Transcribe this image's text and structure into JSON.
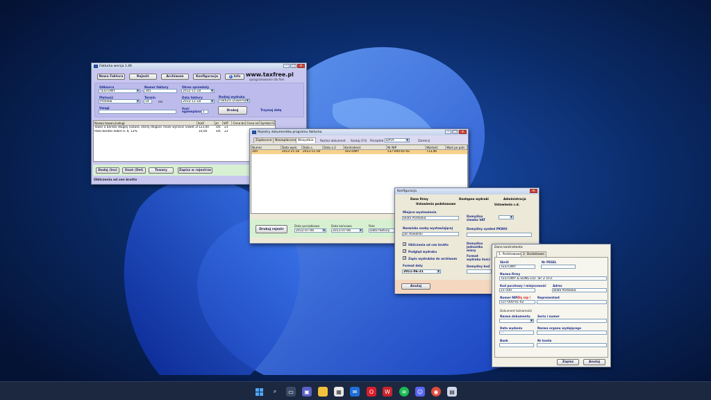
{
  "w1": {
    "title": "Fakturka wersja 1.46",
    "menu": [
      "Nowa Faktura",
      "Rejestr",
      "Archiwum",
      "Konfiguracja",
      "Info"
    ],
    "logo": "www.taxfree.pl",
    "logo_sub": "oprogramowanie dla firm",
    "odbiorca_lbl": "Odbiorca",
    "odbiorca": "TESTOWY",
    "numer_lbl": "Numer faktury",
    "numer": "345",
    "okres_lbl": "Okres sprzedaży",
    "okres": "2012-11-18",
    "platnosc_lbl": "Płatność",
    "platnosc": "Przelew",
    "termin_lbl": "Termin",
    "termin": "14",
    "dni": "dni",
    "data_lbl": "Data faktury",
    "data": "2012-11-18",
    "rodzaj_lbl": "Rodzaj wydruku",
    "rodzaj": "Faktura uniwersalna",
    "uwagi_lbl": "Uwagi",
    "ilosc_lbl": "Ilość egzemplarzy",
    "ilosc": "1",
    "drukuj": "Drukuj",
    "trzymaj": "Trzymaj datę",
    "cols": [
      "Nazwa towaru/usługi",
      "Ilość",
      "jm",
      "VAT",
      "Cena brutto",
      "Cena netto",
      "Symbol SWW"
    ],
    "rows": [
      [
        "Towar o bardzo długiej nazwie, której długość może wynosić nawet 200 znaków",
        "123,00",
        "szt.",
        "23",
        "",
        "",
        " "
      ],
      [
        "Pozo bardzo dobre 0..9, 12%",
        "10,00",
        "szt.",
        "23",
        "",
        "",
        ""
      ]
    ],
    "buttons": [
      "Dodaj (Ins)",
      "Usuń (Del)",
      "Towary",
      "Zapisz w rejestrze"
    ],
    "status": "Obliczenia od cen brutto"
  },
  "w2": {
    "title": "Rejestry dokumentów programu fakturka",
    "tabs": [
      "Zapłacone",
      "Niezapłacone",
      "Wszystkie",
      "Rozlicz dokument",
      "Szukaj (F3)",
      "Porządek:"
    ],
    "porzadek": "DATA",
    "zamknij": "Zamknij",
    "cols": [
      "Numer",
      "Data wyst.",
      "Data s.",
      "Data o.2",
      "Kontrahent",
      "Nr NIP",
      "Wartość",
      "Wart.po potr."
    ],
    "row": [
      "345",
      "2012-11-18",
      "2012-11-18",
      "",
      "TESTOWY",
      "537-000-01-02",
      "713,46",
      ""
    ],
    "drukuj": "Drukuj rejestr",
    "dp_lbl": "Data początkowa",
    "dp": "2012-07-06",
    "dk_lbl": "Data końcowa",
    "dk": "2011-07-06",
    "pole_lbl": "Pole",
    "pole": "Data faktury"
  },
  "w3": {
    "title": "Konfiguracja",
    "tabs": [
      "Dane firmy",
      "Dostępne wydruki",
      "Administracja"
    ],
    "subtabs": [
      "Ustawienia podstawowe",
      "Ustawienia c.d."
    ],
    "miejsce_lbl": "Miejsce wystawienia",
    "miejsce": "Biała Podlaska",
    "osoba_lbl": "Nazwisko osoby wystawiającej",
    "osoba": "Jan Kowalski",
    "checks": [
      "Obliczenia od cen brutto",
      "Podgląd wydruku",
      "Zapis wydruków do archiwum"
    ],
    "format_lbl": "Format daty",
    "format": "2011-06-21",
    "vat_lbl": "Domyślna stawka VAT",
    "pkwiu_lbl": "Domyślny symbol PKWiU",
    "jedn_lbl": "Domyślna jednostka miary",
    "format_wyd_lbl": "Format wydruku ilości (miejsca po przecinku)",
    "kod_lbl": "Domyślny kod",
    "anuluj": "Anuluj"
  },
  "w4": {
    "title": "Dane kontrahenta",
    "tabs": [
      "1. Podstawowe",
      "2. Dodatkowe"
    ],
    "skrot_lbl": "Skrót",
    "skrot": "TESTOWY",
    "pesel_lbl": "Nr PESEL",
    "nazwa_lbl": "Nazwa firmy",
    "nazwa": "TESTOWY & SONS LTD. SP. Z O.O.",
    "kod_lbl": "Kod pocztowy i miejscowość",
    "kod": "21-500",
    "adres_lbl": "Adres",
    "adres": "Biała Podlaska",
    "nip_lbl": "Numer NIP",
    "nip_bad": "Zły nip !",
    "nip": "537-000-01-02",
    "rep_lbl": "Reprezentant",
    "dok_lbl": "Dokument tożsamości",
    "nazwa_dok_lbl": "Nazwa dokumentu",
    "seria_lbl": "Seria i numer",
    "data_wyd_lbl": "Data wydania",
    "data_wyd": "- -",
    "organ_lbl": "Nazwa organu wydającego",
    "bank_lbl": "Bank",
    "konto_lbl": "Nr konta",
    "zapisz": "Zapisz",
    "anuluj": "Anuluj"
  }
}
